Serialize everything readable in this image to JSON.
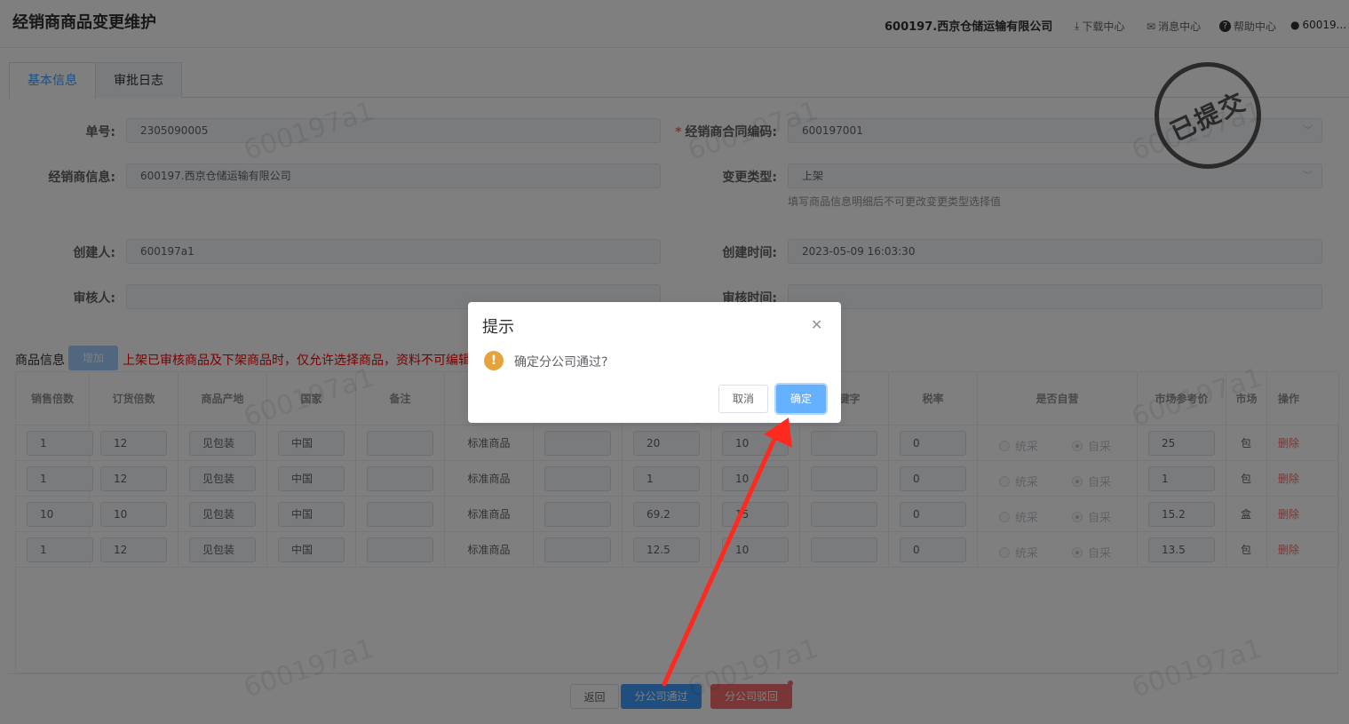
{
  "header": {
    "title": "经销商商品变更维护",
    "company": "600197.西京仓储运输有限公司",
    "links": {
      "download": "下载中心",
      "messages": "消息中心",
      "help": "帮助中心",
      "user": "60019..."
    }
  },
  "tabs": [
    {
      "label": "基本信息"
    },
    {
      "label": "审批日志"
    }
  ],
  "form": {
    "order_no": {
      "label": "单号:",
      "value": "2305090005"
    },
    "contract_code": {
      "label": "经销商合同编码:",
      "value": "600197001",
      "required": "*"
    },
    "dealer_info": {
      "label": "经销商信息:",
      "value": "600197.西京仓储运输有限公司"
    },
    "change_type": {
      "label": "变更类型:",
      "value": "上架",
      "hint": "填写商品信息明细后不可更改变更类型选择值"
    },
    "creator": {
      "label": "创建人:",
      "value": "600197a1"
    },
    "create_time": {
      "label": "创建时间:",
      "value": "2023-05-09 16:03:30"
    },
    "reviewer": {
      "label": "审核人:",
      "value": ""
    },
    "review_time": {
      "label": "审核时间:",
      "value": ""
    }
  },
  "stamp": {
    "text": "已提交"
  },
  "watermark": {
    "text": "600197a1"
  },
  "products": {
    "label": "商品信息",
    "add_label": "增加",
    "warning": "上架已审核商品及下架商品时，仅允许选择商品，资料不可编辑",
    "columns": [
      "销售倍数",
      "订货倍数",
      "商品产地",
      "国家",
      "备注",
      "",
      "",
      "",
      "",
      "关键字",
      "税率",
      "是否自营",
      "市场参考价",
      "市场",
      "操作"
    ],
    "radio_labels": {
      "unified": "统采",
      "self": "自采"
    },
    "delete_label": "删除",
    "rows": [
      {
        "sale_mult": "1",
        "order_mult": "12",
        "origin": "见包装",
        "country": "中国",
        "remark": "",
        "type": "标准商品",
        "c7": "",
        "c8": "20",
        "c9": "10",
        "keyword": "",
        "tax": "0",
        "ref_price": "25",
        "unit": "包"
      },
      {
        "sale_mult": "1",
        "order_mult": "12",
        "origin": "见包装",
        "country": "中国",
        "remark": "",
        "type": "标准商品",
        "c7": "",
        "c8": "1",
        "c9": "10",
        "keyword": "",
        "tax": "0",
        "ref_price": "1",
        "unit": "包"
      },
      {
        "sale_mult": "10",
        "order_mult": "10",
        "origin": "见包装",
        "country": "中国",
        "remark": "",
        "type": "标准商品",
        "c7": "",
        "c8": "69.2",
        "c9": "15",
        "keyword": "",
        "tax": "0",
        "ref_price": "15.2",
        "unit": "盒"
      },
      {
        "sale_mult": "1",
        "order_mult": "12",
        "origin": "见包装",
        "country": "中国",
        "remark": "",
        "type": "标准商品",
        "c7": "",
        "c8": "12.5",
        "c9": "10",
        "keyword": "",
        "tax": "0",
        "ref_price": "13.5",
        "unit": "包"
      }
    ]
  },
  "footer": {
    "back": "返回",
    "approve": "分公司通过",
    "reject": "分公司驳回"
  },
  "dialog": {
    "title": "提示",
    "message": "确定分公司通过?",
    "cancel": "取消",
    "confirm": "确定"
  },
  "colors": {
    "primary": "#409eff",
    "danger": "#f56c6c",
    "warning": "#e6a23c",
    "arrow": "#ff2a1f"
  }
}
